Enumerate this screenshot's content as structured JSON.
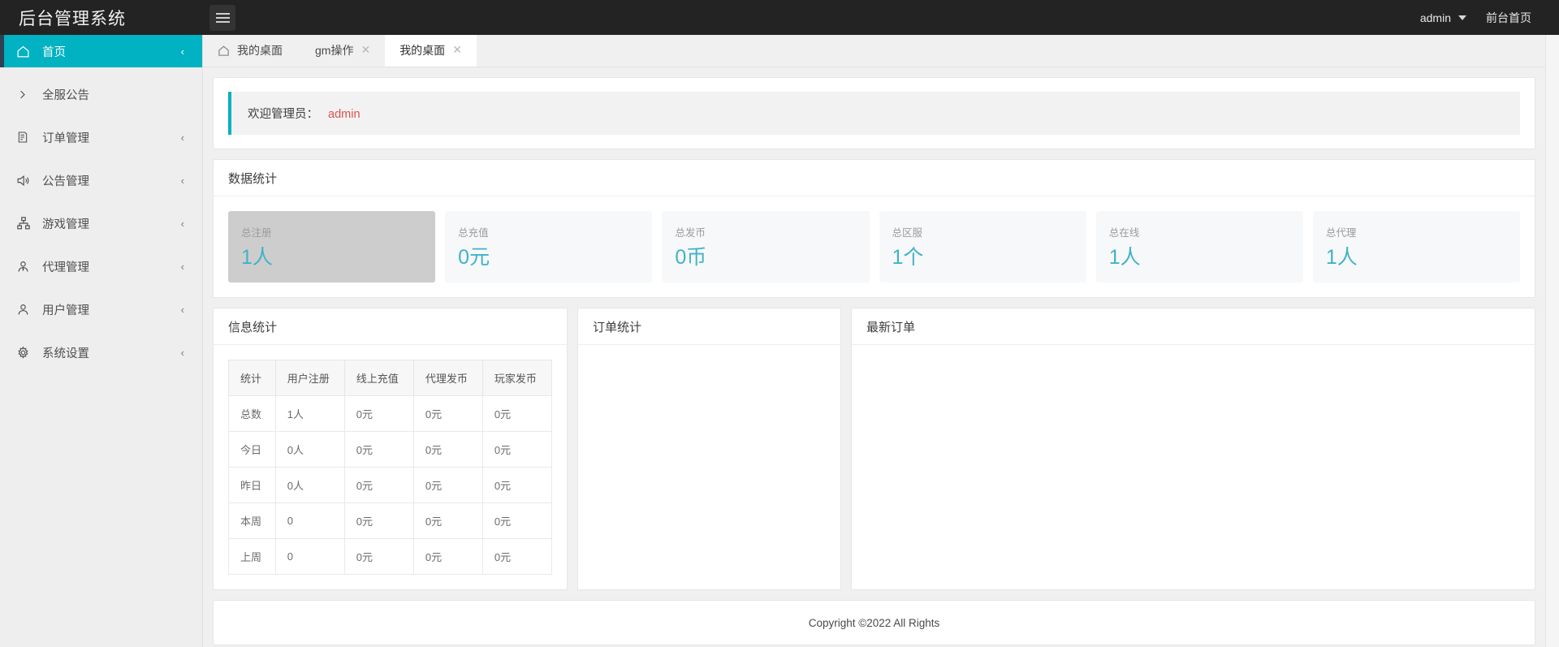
{
  "header": {
    "brand_title": "后台管理系统",
    "menu_toggle_icon": "hamburger-icon",
    "user_name": "admin",
    "front_page_link": "前台首页"
  },
  "sidebar": {
    "items": [
      {
        "label": "首页",
        "icon": "home-icon",
        "arrow": "‹",
        "active": true
      },
      {
        "label": "全服公告",
        "icon": "chevron-right-icon",
        "arrow": "",
        "active": false
      },
      {
        "label": "订单管理",
        "icon": "file-icon",
        "arrow": "‹",
        "active": false
      },
      {
        "label": "公告管理",
        "icon": "megaphone-icon",
        "arrow": "‹",
        "active": false
      },
      {
        "label": "游戏管理",
        "icon": "sitemap-icon",
        "arrow": "‹",
        "active": false
      },
      {
        "label": "代理管理",
        "icon": "agent-user-icon",
        "arrow": "‹",
        "active": false
      },
      {
        "label": "用户管理",
        "icon": "user-icon",
        "arrow": "‹",
        "active": false
      },
      {
        "label": "系统设置",
        "icon": "gear-icon",
        "arrow": "‹",
        "active": false
      }
    ]
  },
  "tabs": [
    {
      "label": "我的桌面",
      "icon": "home-icon",
      "closable": false,
      "active": false
    },
    {
      "label": "gm操作",
      "icon": "",
      "closable": true,
      "active": false
    },
    {
      "label": "我的桌面",
      "icon": "",
      "closable": true,
      "active": true
    }
  ],
  "tab_close_glyph": "✕",
  "welcome": {
    "text": "欢迎管理员：",
    "user": "admin"
  },
  "data_stats": {
    "title": "数据统计",
    "cells": [
      {
        "label": "总注册",
        "value": "1人",
        "highlight": true
      },
      {
        "label": "总充值",
        "value": "0元",
        "highlight": false
      },
      {
        "label": "总发币",
        "value": "0币",
        "highlight": false
      },
      {
        "label": "总区服",
        "value": "1个",
        "highlight": false
      },
      {
        "label": "总在线",
        "value": "1人",
        "highlight": false
      },
      {
        "label": "总代理",
        "value": "1人",
        "highlight": false
      }
    ]
  },
  "info_stats": {
    "title": "信息统计",
    "columns": [
      "统计",
      "用户注册",
      "线上充值",
      "代理发币",
      "玩家发币"
    ],
    "rows": [
      [
        "总数",
        "1人",
        "0元",
        "0元",
        "0元"
      ],
      [
        "今日",
        "0人",
        "0元",
        "0元",
        "0元"
      ],
      [
        "昨日",
        "0人",
        "0元",
        "0元",
        "0元"
      ],
      [
        "本周",
        "0",
        "0元",
        "0元",
        "0元"
      ],
      [
        "上周",
        "0",
        "0元",
        "0元",
        "0元"
      ]
    ]
  },
  "order_stats": {
    "title": "订单统计"
  },
  "latest_orders": {
    "title": "最新订单"
  },
  "footer": {
    "copyright": "Copyright ©2022 All Rights"
  },
  "colors": {
    "accent": "#00b2c2",
    "header_bg": "#232323",
    "sidebar_bg": "#eeeeee",
    "value_text": "#3fb3c8",
    "user_highlight": "#d9534f",
    "active_border": "#2f4050"
  }
}
